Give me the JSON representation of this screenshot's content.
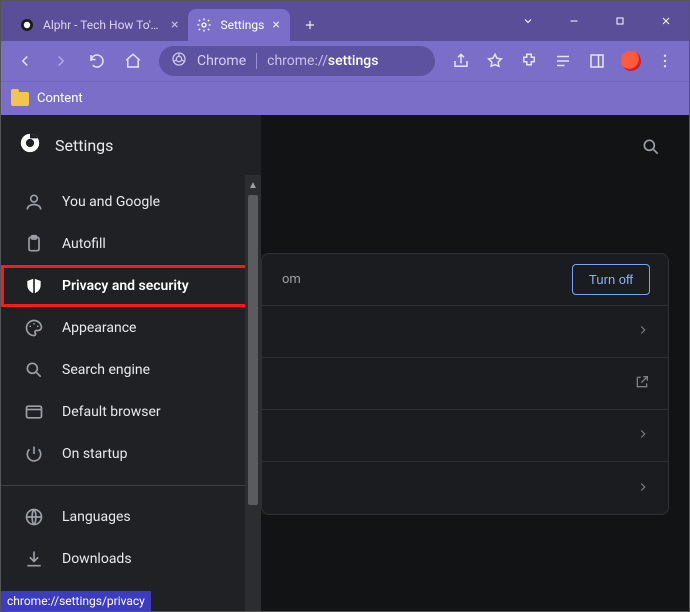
{
  "tabs": [
    {
      "label": "Alphr - Tech How To's & G",
      "active": false
    },
    {
      "label": "Settings",
      "active": true
    }
  ],
  "omnibox": {
    "scheme_label": "Chrome",
    "url_prefix": "chrome://",
    "url_bold": "settings"
  },
  "bookmarks": {
    "item1": "Content"
  },
  "sidebar": {
    "title": "Settings",
    "items": [
      {
        "label": "You and Google"
      },
      {
        "label": "Autofill"
      },
      {
        "label": "Privacy and security"
      },
      {
        "label": "Appearance"
      },
      {
        "label": "Search engine"
      },
      {
        "label": "Default browser"
      },
      {
        "label": "On startup"
      }
    ],
    "items2": [
      {
        "label": "Languages"
      },
      {
        "label": "Downloads"
      }
    ]
  },
  "main": {
    "row0_text": "om",
    "turn_off": "Turn off"
  },
  "status": "chrome://settings/privacy"
}
